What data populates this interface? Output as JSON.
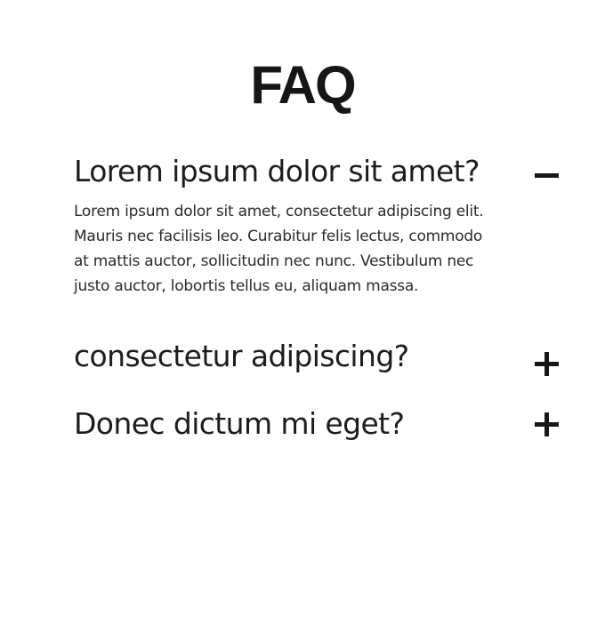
{
  "page": {
    "title": "FAQ"
  },
  "faq": {
    "items": [
      {
        "question": "Lorem ipsum dolor sit amet?",
        "answer": "Lorem ipsum dolor sit amet, consectetur adipiscing elit. Mauris nec facilisis leo. Curabitur felis lectus, commodo at mattis auctor, sollicitudin nec nunc. Vestibulum nec justo auctor, lobortis tellus eu, aliquam massa.",
        "expanded": true,
        "toggle_icon": "minus-icon"
      },
      {
        "question": "consectetur adipiscing?",
        "answer": "",
        "expanded": false,
        "toggle_icon": "plus-icon"
      },
      {
        "question": "Donec dictum mi eget?",
        "answer": "",
        "expanded": false,
        "toggle_icon": "plus-icon"
      }
    ]
  },
  "colors": {
    "text": "#1a1a1a",
    "background": "#ffffff"
  }
}
